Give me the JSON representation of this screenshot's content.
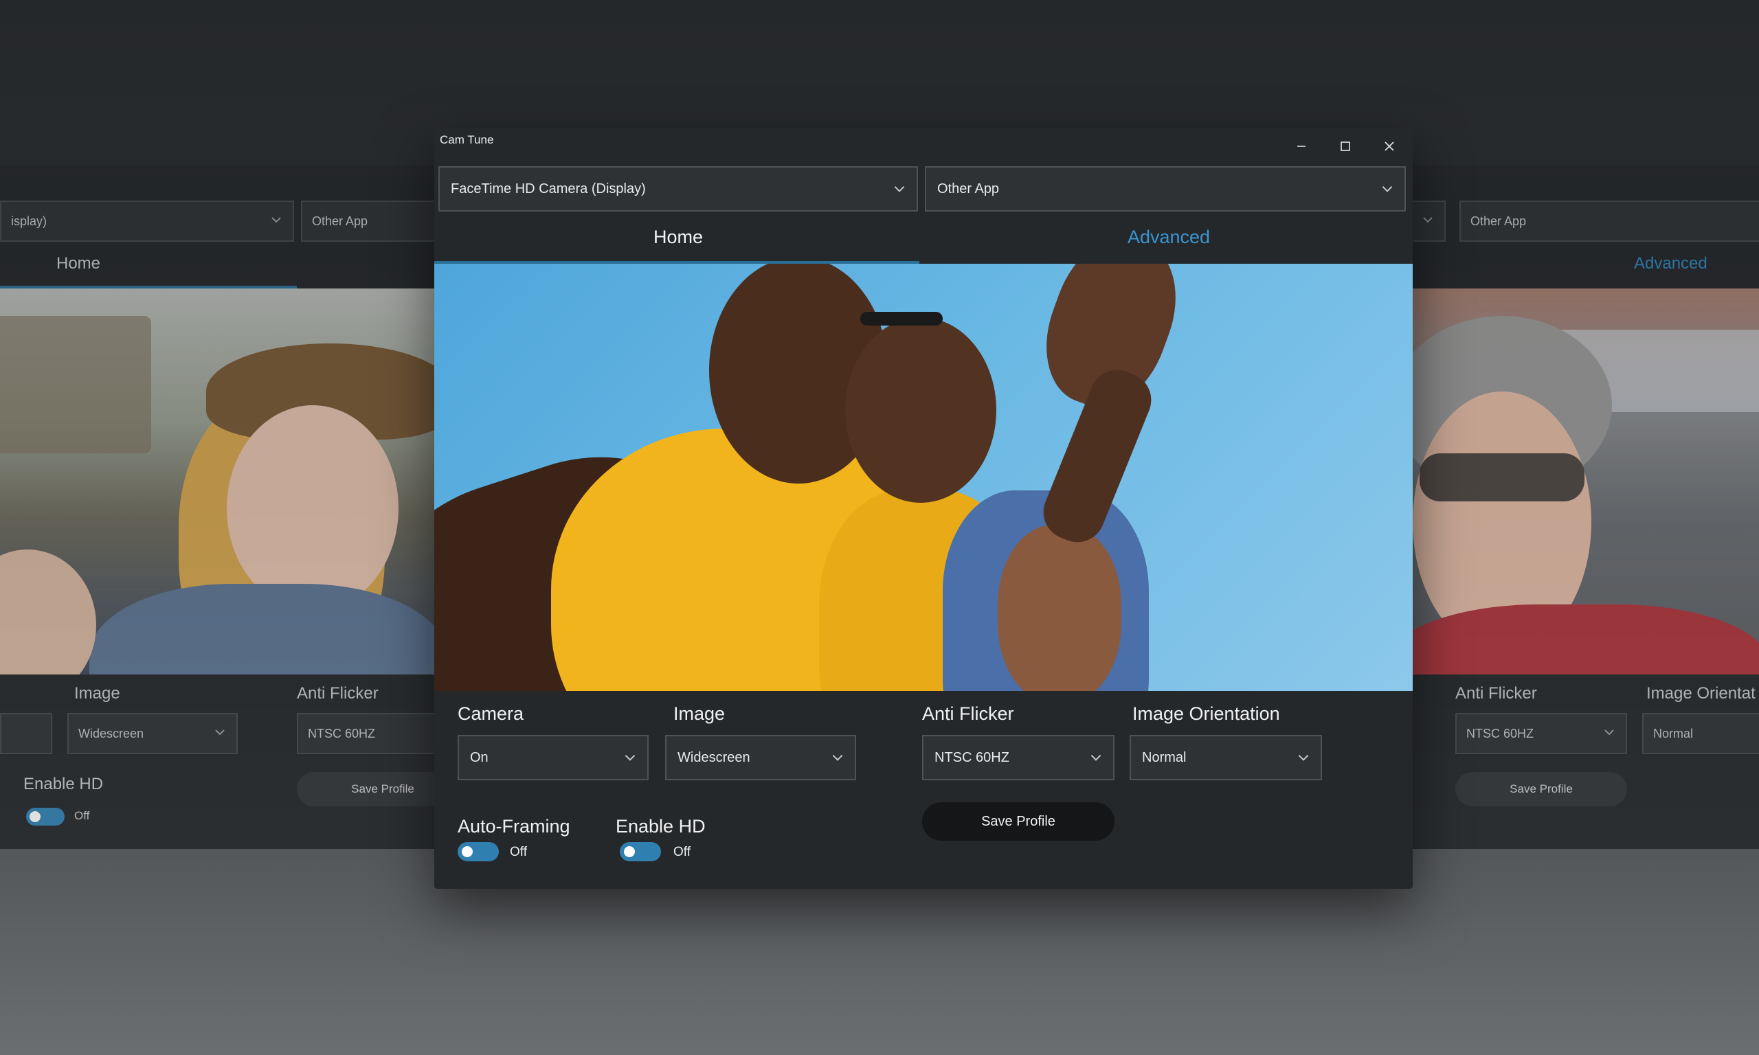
{
  "window": {
    "title": "Cam Tune",
    "camera_select": "FaceTime HD Camera (Display)",
    "app_select": "Other App",
    "tabs": {
      "home": "Home",
      "advanced": "Advanced"
    },
    "controls": {
      "camera": {
        "label": "Camera",
        "value": "On"
      },
      "image": {
        "label": "Image",
        "value": "Widescreen"
      },
      "anti_flicker": {
        "label": "Anti Flicker",
        "value": "NTSC 60HZ"
      },
      "orientation": {
        "label": "Image Orientation",
        "value": "Normal"
      },
      "save_profile": "Save Profile",
      "auto_framing": {
        "label": "Auto-Framing",
        "state": "Off"
      },
      "enable_hd": {
        "label": "Enable HD",
        "state": "Off"
      }
    }
  },
  "ghost_left": {
    "camera_select": "isplay)",
    "app_select": "Other App",
    "tab_home": "Home",
    "image_label": "Image",
    "image_value": "Widescreen",
    "anti_flicker_label": "Anti Flicker",
    "anti_flicker_value": "NTSC 60HZ",
    "enable_hd_label": "Enable HD",
    "enable_hd_state": "Off",
    "save_profile": "Save Profile"
  },
  "ghost_right": {
    "app_select": "Other App",
    "tab_advanced": "Advanced",
    "anti_flicker_label": "Anti Flicker",
    "anti_flicker_value": "NTSC 60HZ",
    "orientation_label": "Image Orientat",
    "orientation_value": "Normal",
    "save_profile": "Save Profile"
  },
  "colors": {
    "accent": "#3a95cf",
    "toggle": "#2f7fb0",
    "window_bg": "#25282b"
  },
  "icons": [
    "minimize-icon",
    "maximize-icon",
    "close-icon",
    "chevron-down-icon"
  ]
}
